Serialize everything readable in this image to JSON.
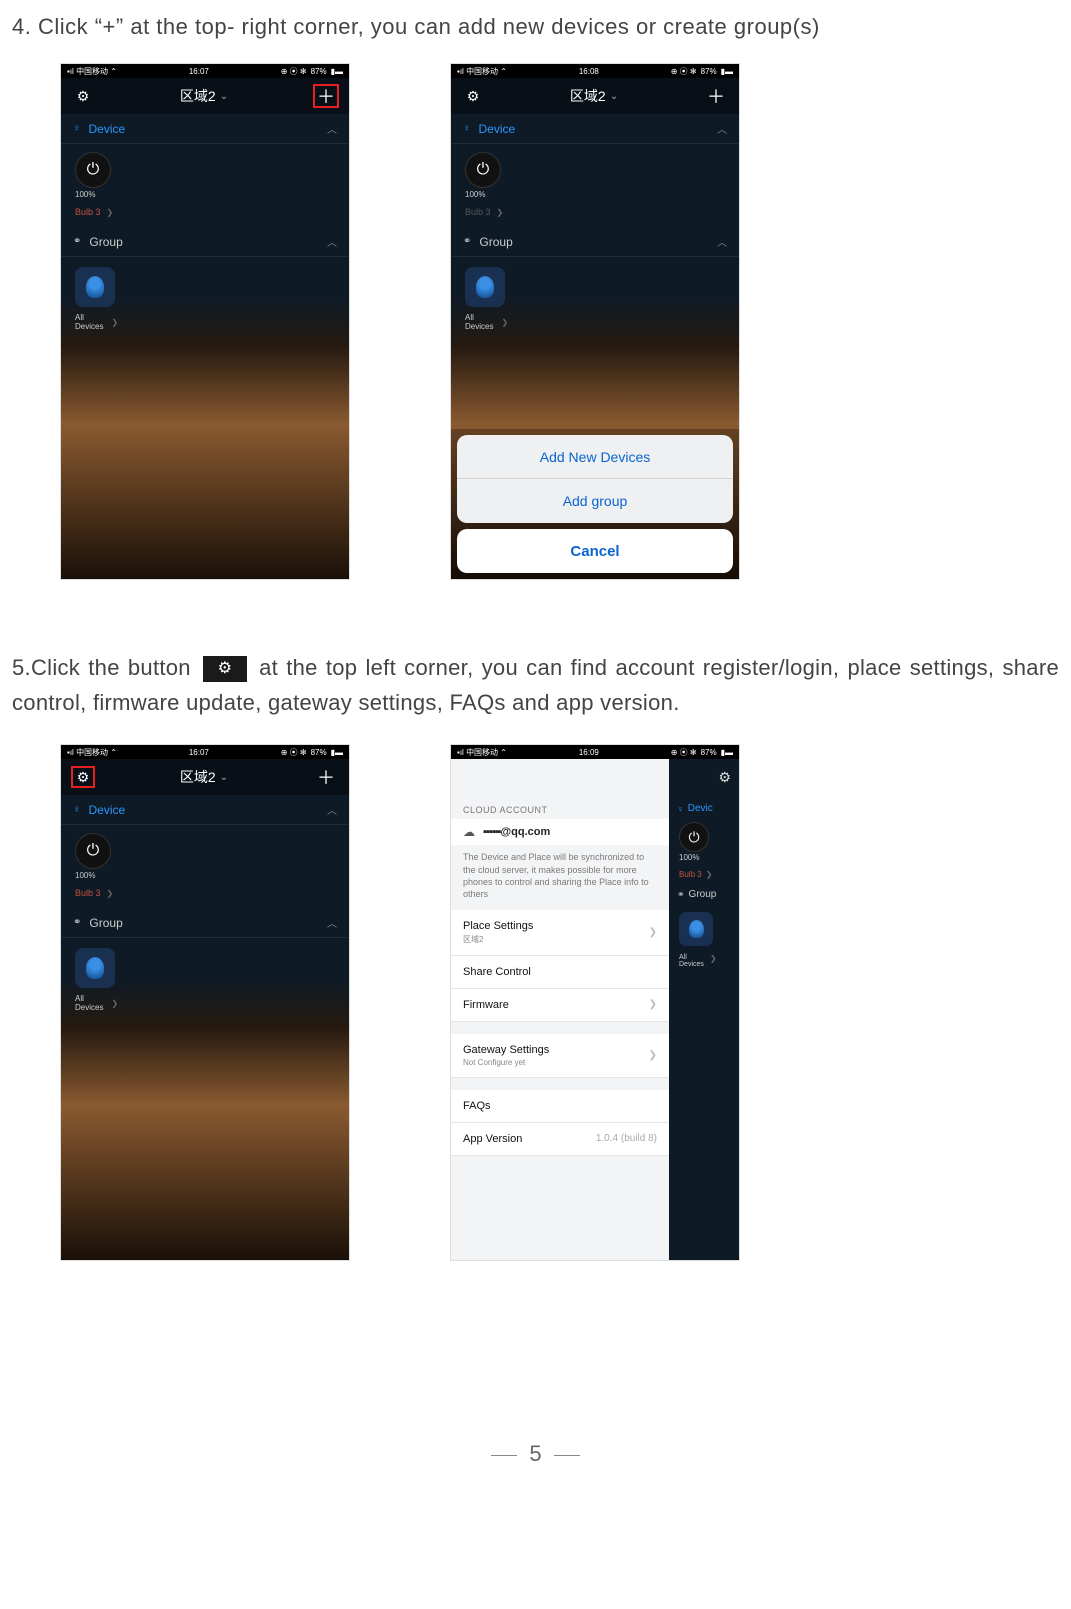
{
  "step4": {
    "text": "4. Click  “+”  at the top- right corner, you can add new devices or create group(s)"
  },
  "step5": {
    "pre": "5.Click  the  button ",
    "post": " at  the  top  left  corner,  you  can  find  account  register/login, place settings, share control, firmware update, gateway settings, FAQs and app version."
  },
  "statusbar": {
    "carrier": "中国移动",
    "time1": "16:07",
    "time2": "16:08",
    "time3": "16:07",
    "time4": "16:09",
    "battery": "87%"
  },
  "topbar": {
    "zone": "区域2"
  },
  "sections": {
    "device": "Device",
    "group": "Group"
  },
  "device": {
    "percent": "100%",
    "bulb": "Bulb 3"
  },
  "group": {
    "all_line1": "All",
    "all_line2": "Devices"
  },
  "sheet": {
    "add_devices": "Add New Devices",
    "add_group": "Add group",
    "cancel": "Cancel"
  },
  "settings": {
    "cloud_header": "CLOUD ACCOUNT",
    "email_redacted": "▪▪▪▪▪▪",
    "email_suffix": "@qq.com",
    "desc": "The Device and Place will be synchronized to the cloud server, it makes possible for more phones to control and sharing the Place info to others",
    "place_settings": "Place Settings",
    "place_sub": "区域2",
    "share_control": "Share Control",
    "firmware": "Firmware",
    "gateway": "Gateway Settings",
    "gateway_sub": "Not Configure yet",
    "faqs": "FAQs",
    "app_version": "App Version",
    "version_value": "1.0.4 (build 8)"
  },
  "footer": {
    "page": "5"
  }
}
